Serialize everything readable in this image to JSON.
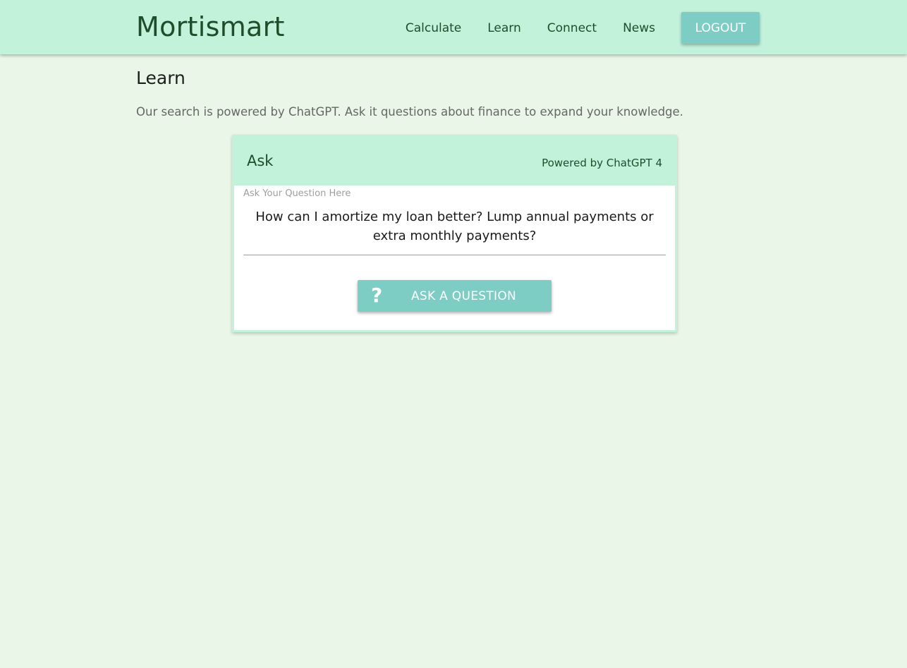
{
  "header": {
    "brand": "Mortismart",
    "nav": [
      "Calculate",
      "Learn",
      "Connect",
      "News"
    ],
    "logout_label": "LOGOUT"
  },
  "page": {
    "title": "Learn",
    "intro": "Our search is powered by ChatGPT. Ask it questions about finance to expand your knowledge."
  },
  "ask_card": {
    "title": "Ask",
    "subtitle": "Powered by ChatGPT 4",
    "field_label": "Ask Your Question Here",
    "field_value": "How can I amortize my loan better? Lump annual payments or extra monthly payments?",
    "button_icon": "question-mark-icon",
    "button_icon_glyph": "?",
    "button_label": "ASK A QUESTION"
  },
  "colors": {
    "background": "#eaf7e8",
    "header": "#c3f2db",
    "accent_button": "#7ecdc4",
    "brand_text": "#1f4d2c"
  }
}
